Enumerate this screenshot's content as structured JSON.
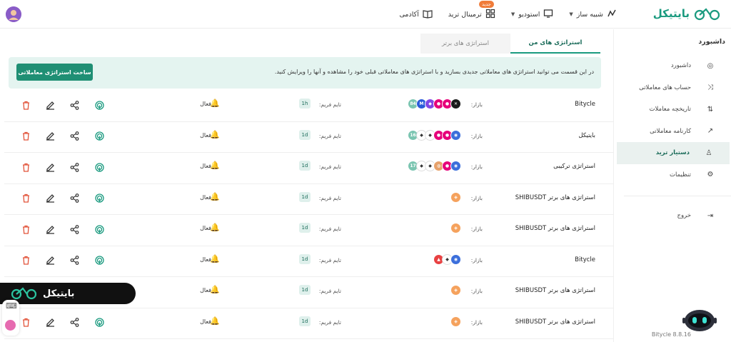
{
  "header": {
    "logo_text": "بایتیکل",
    "nav": [
      {
        "label": "شبیه ساز",
        "icon": "simulator-icon",
        "has_menu": true
      },
      {
        "label": "استودیو",
        "icon": "monitor-icon",
        "has_menu": true
      },
      {
        "label": "ترمینال ترید",
        "icon": "grid-icon",
        "has_menu": false,
        "badge": "جدید"
      },
      {
        "label": "آکادمی",
        "icon": "book-icon",
        "has_menu": false
      }
    ]
  },
  "sidebar": {
    "title": "داشبورد",
    "items": [
      {
        "label": "داشبورد",
        "icon": "dashboard-icon",
        "active": false
      },
      {
        "label": "حساب های معاملاتی",
        "icon": "accounts-icon",
        "active": false
      },
      {
        "label": "تاریخچه معاملات",
        "icon": "history-icon",
        "active": false
      },
      {
        "label": "کارنامه معاملاتی",
        "icon": "chart-trend-icon",
        "active": false
      },
      {
        "label": "دستیار ترید",
        "icon": "robot-assistant-icon",
        "active": true
      },
      {
        "label": "تنظیمات",
        "icon": "settings-icon",
        "active": false
      }
    ],
    "logout": "خروج",
    "version": "Bitycle 8.8.16"
  },
  "tabs": [
    {
      "label": "استراتژی های من",
      "active": true
    },
    {
      "label": "استراتژی های برتر",
      "active": false
    }
  ],
  "info": {
    "text": "در این قسمت می توانید استراتژی های معاملاتی جدیدی بسازید و با استراتژی های معاملاتی قبلی خود را مشاهده و آنها را ویرایش کنید.",
    "create_button": "ساخت استراتژی معاملاتی"
  },
  "labels": {
    "market": "بازار:",
    "timeframe": "تایم فریم:",
    "status": "فعال"
  },
  "rows": [
    {
      "name": "Bitycle",
      "timeframe": "1h",
      "coins": [
        "#1b1b1b",
        "#e6007a",
        "#e6007a",
        "#8247e5",
        "#2a5ada",
        "#7bc5b1"
      ],
      "coin_glyphs": [
        "✕",
        "●",
        "●",
        "◆",
        "M",
        "84"
      ]
    },
    {
      "name": "بایتیکل",
      "timeframe": "1d",
      "coins": [
        "#3c6fdb",
        "#e6007a",
        "#e6007a",
        "#ffffff",
        "#ffffff",
        "#7bc5b1"
      ],
      "coin_glyphs": [
        "◉",
        "●",
        "●",
        "◆",
        "◆",
        "16"
      ]
    },
    {
      "name": "استراتژی ترکیبی",
      "timeframe": "1d",
      "coins": [
        "#3c6fdb",
        "#e6007a",
        "#e6a16a",
        "#ffffff",
        "#ffffff",
        "#7bc5b1"
      ],
      "coin_glyphs": [
        "◉",
        "●",
        "◍",
        "◆",
        "◆",
        "17"
      ]
    },
    {
      "name": "استراتژی های برتر SHIBUSDT",
      "timeframe": "1d",
      "coins": [
        "#f5a25d"
      ],
      "coin_glyphs": [
        "◈"
      ]
    },
    {
      "name": "استراتژی های برتر SHIBUSDT",
      "timeframe": "1d",
      "coins": [
        "#f5a25d"
      ],
      "coin_glyphs": [
        "◈"
      ]
    },
    {
      "name": "Bitycle",
      "timeframe": "1d",
      "coins": [
        "#3c6fdb",
        "#ffffff",
        "#e84142"
      ],
      "coin_glyphs": [
        "◉",
        "◆",
        "▲"
      ]
    },
    {
      "name": "استراتژی های برتر SHIBUSDT",
      "timeframe": "1d",
      "coins": [
        "#f5a25d"
      ],
      "coin_glyphs": [
        "◈"
      ]
    },
    {
      "name": "استراتژی های برتر SHIBUSDT",
      "timeframe": "1d",
      "coins": [
        "#f5a25d"
      ],
      "coin_glyphs": [
        "◈"
      ]
    }
  ],
  "colors": {
    "accent": "#1a9a7f",
    "button": "#1f8f74",
    "delete": "#e2533a"
  }
}
